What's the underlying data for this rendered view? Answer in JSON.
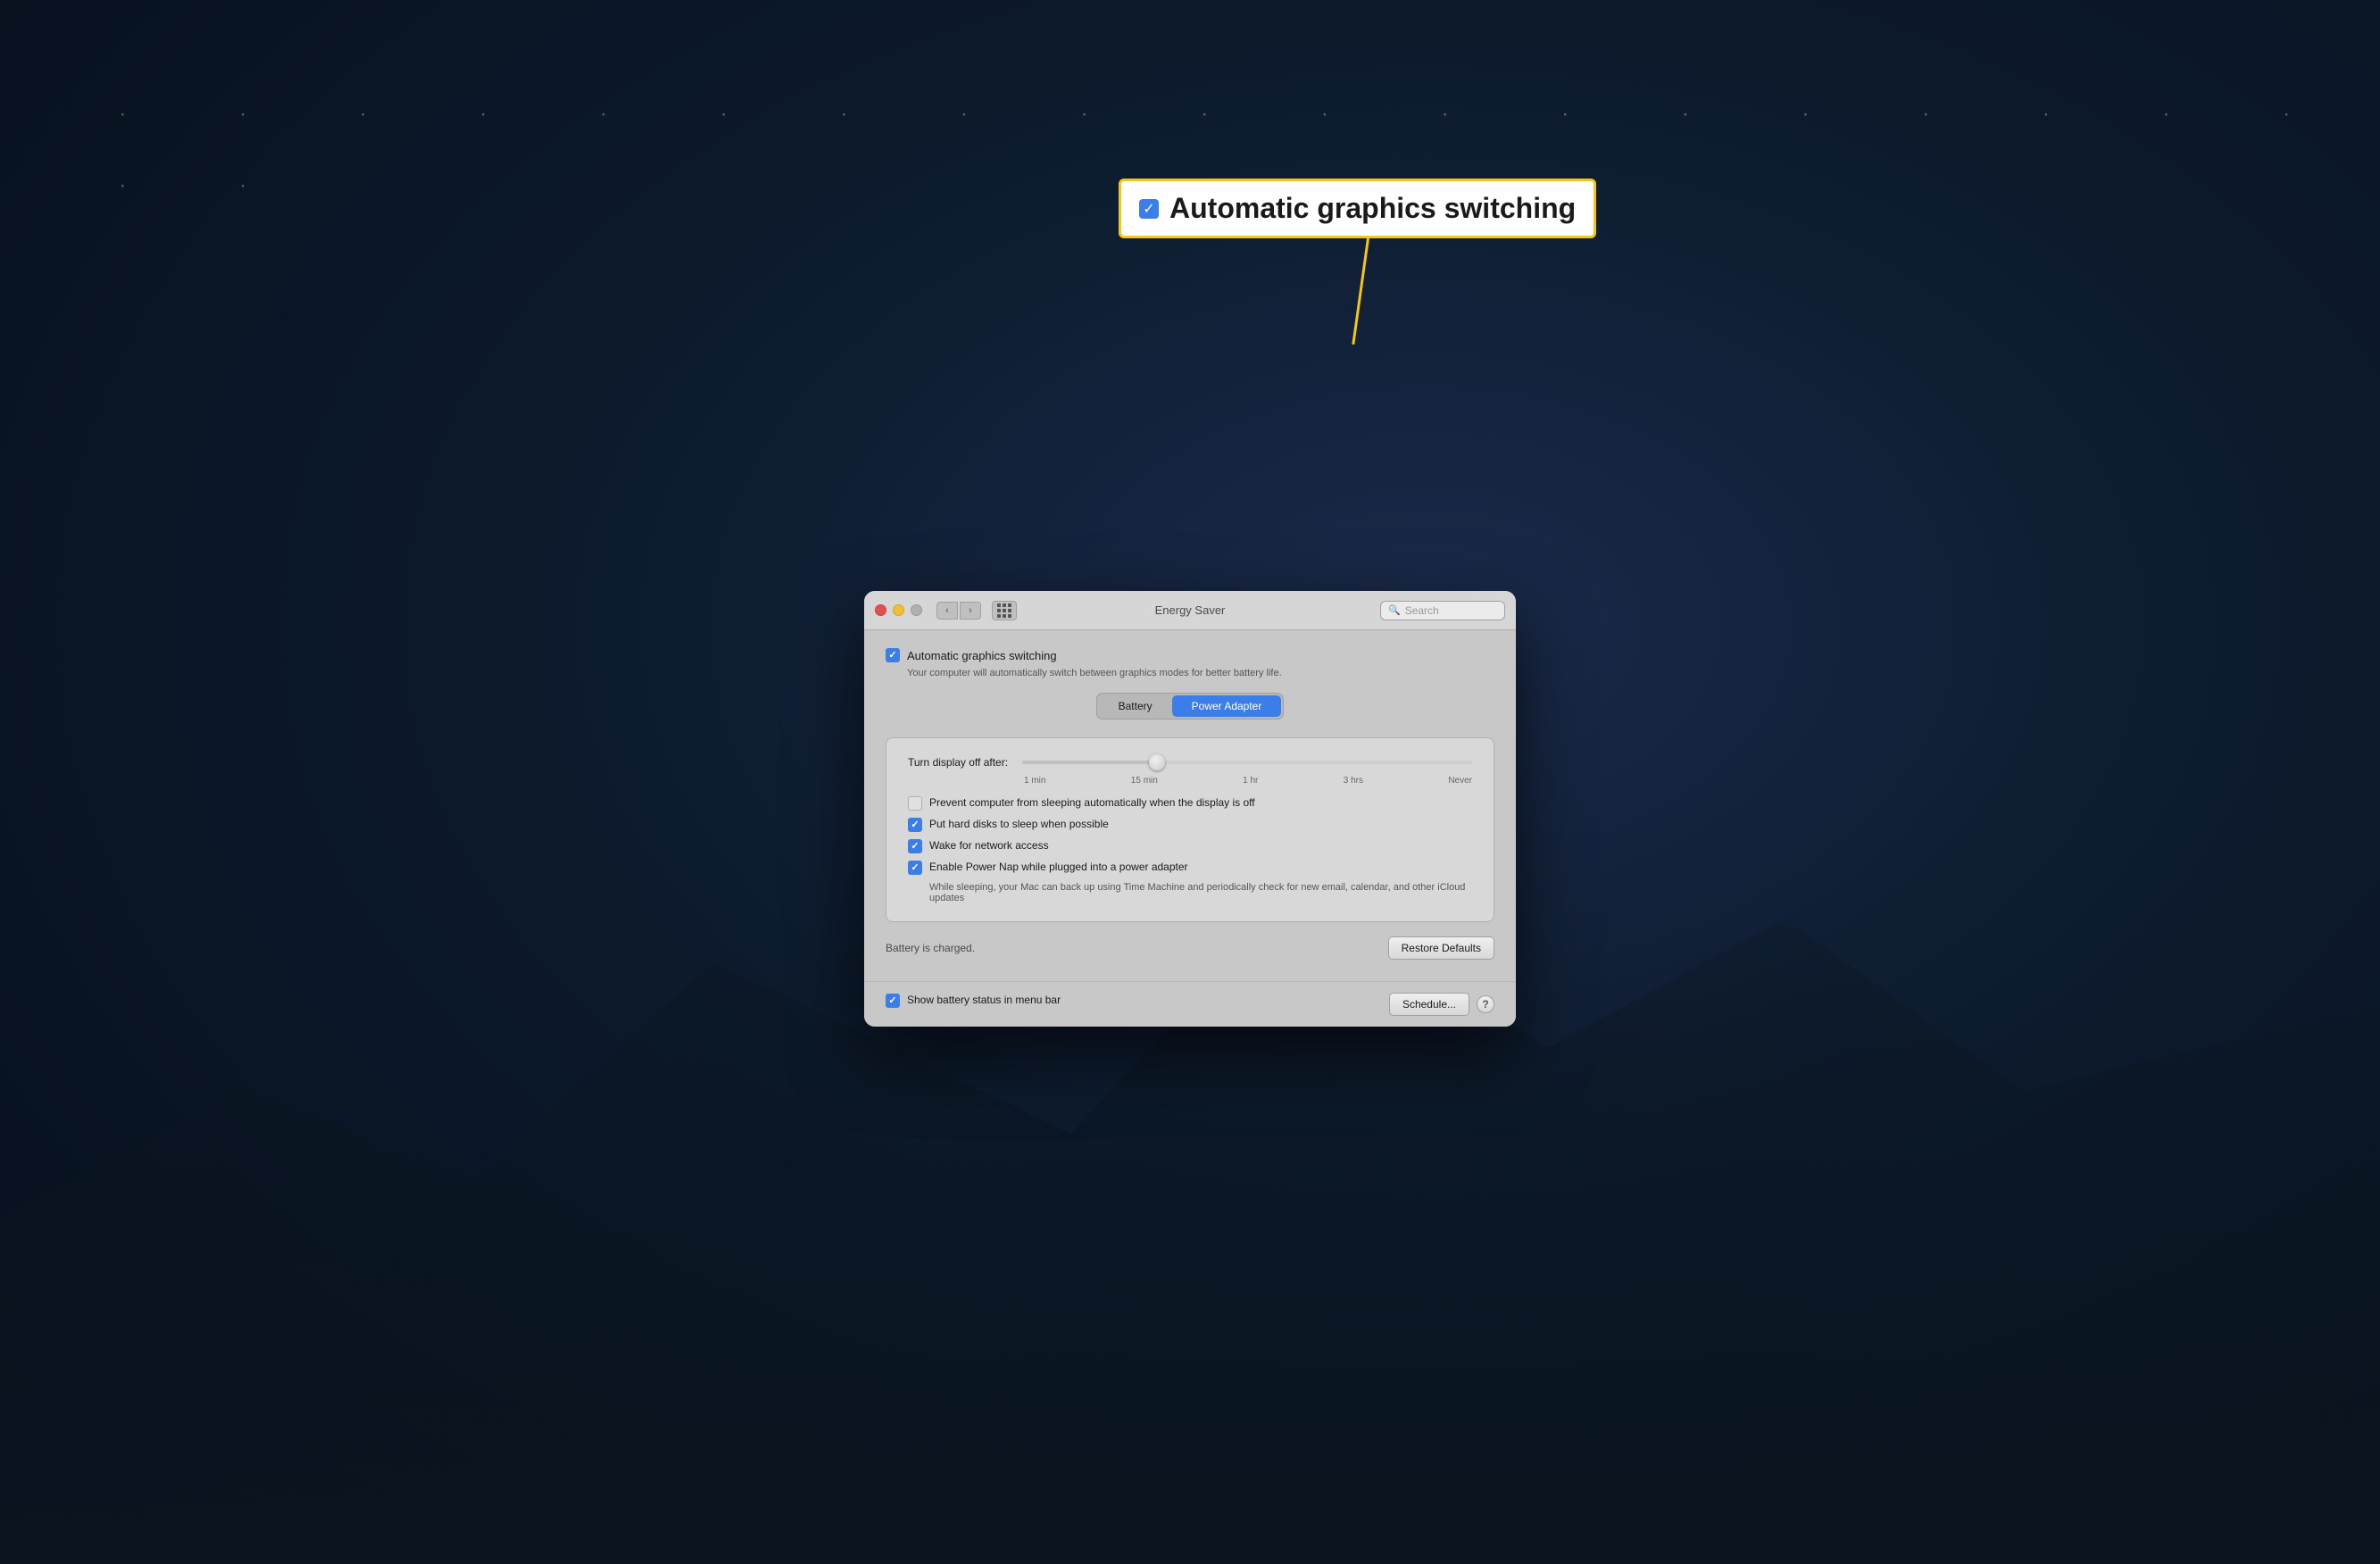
{
  "callout": {
    "text": "Automatic graphics switching",
    "checkbox_checked": true
  },
  "window": {
    "title": "Energy Saver",
    "search_placeholder": "Search",
    "traffic_lights": {
      "close": "close",
      "minimize": "minimize",
      "maximize": "maximize"
    },
    "nav": {
      "back": "‹",
      "forward": "›"
    }
  },
  "content": {
    "auto_graphics": {
      "label": "Automatic graphics switching",
      "description": "Your computer will automatically switch between graphics modes for better battery life.",
      "checked": true
    },
    "segments": {
      "battery": "Battery",
      "power_adapter": "Power Adapter",
      "active": "power_adapter"
    },
    "slider": {
      "label": "Turn display off after:",
      "ticks": [
        "1 min",
        "15 min",
        "1 hr",
        "3 hrs",
        "Never"
      ],
      "position": 30
    },
    "checkboxes": [
      {
        "id": "prevent-sleep",
        "label": "Prevent computer from sleeping automatically when the display is off",
        "checked": false,
        "sub": null
      },
      {
        "id": "hard-disks",
        "label": "Put hard disks to sleep when possible",
        "checked": true,
        "sub": null
      },
      {
        "id": "wake-network",
        "label": "Wake for network access",
        "checked": true,
        "sub": null
      },
      {
        "id": "power-nap",
        "label": "Enable Power Nap while plugged into a power adapter",
        "checked": true,
        "sub": "While sleeping, your Mac can back up using Time Machine and periodically check for new email, calendar, and other iCloud updates"
      }
    ],
    "status": "Battery is charged.",
    "restore_defaults": "Restore Defaults",
    "show_battery": {
      "label": "Show battery status in menu bar",
      "checked": true
    },
    "schedule_btn": "Schedule...",
    "help_btn": "?"
  }
}
